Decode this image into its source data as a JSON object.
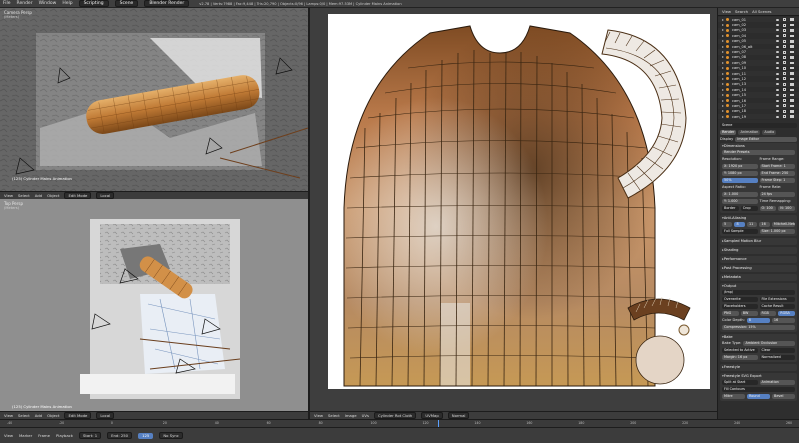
{
  "topbar": {
    "menus": [
      "File",
      "Render",
      "Window",
      "Help"
    ],
    "layout_select": "Scripting",
    "scene_select": "Scene",
    "engine_select": "Blender Render",
    "info_text": "v2.78 | Verts:7988 | Fac:9,448 | Tris:20,790 | Objects:0/96 | Lamps:0/0 | Mem:97.53M | Cylinder Mains Animation"
  },
  "camera_view": {
    "label": "Camera Persp",
    "sublabel": "(Meters)",
    "object_name": "(125) Cylinder Mains Animation",
    "header": [
      "View",
      "Select",
      "Add",
      "Object"
    ],
    "mode": "Edit Mode",
    "pivot": "Local"
  },
  "top_view": {
    "label": "Top Persp",
    "sublabel": "(Meters)",
    "object_name": "(125) Cylinder Mains Animation",
    "header": [
      "View",
      "Select",
      "Add",
      "Object"
    ],
    "mode": "Edit Mode",
    "pivot": "Local"
  },
  "uv_editor": {
    "header": [
      "View",
      "Select",
      "Image",
      "UVs"
    ],
    "image_select": "Cylinder Rot Cloth",
    "uvmap": "UVMap",
    "image_mode": "Normal"
  },
  "outliner": {
    "header": [
      "View",
      "Search",
      "All Scenes"
    ],
    "items": [
      "cam_01",
      "cam_02",
      "cam_03",
      "cam_04",
      "cam_05",
      "cam_06_alt",
      "cam_07",
      "cam_08",
      "cam_09",
      "cam_10",
      "cam_11",
      "cam_12",
      "cam_13",
      "cam_14",
      "cam_15",
      "cam_16",
      "cam_17",
      "cam_18",
      "cam_19",
      "cam_20"
    ]
  },
  "properties": {
    "scene_name": "Scene",
    "tabs": [
      "Render",
      "Animation",
      "Audio"
    ],
    "display_label": "Display",
    "display_value": "Image Editor",
    "dimensions": "Dimensions",
    "render_presets": "Render Presets",
    "resolution": "Resolution:",
    "res_x": "X: 1920 px",
    "res_y": "Y: 1080 px",
    "res_pct": "50%",
    "frame_range": "Frame Range:",
    "start_frame": "Start Frame: 1",
    "end_frame": "End Frame: 250",
    "frame_step": "Frame Step: 1",
    "aspect_ratio": "Aspect Ratio:",
    "asp_x": "X: 1.000",
    "asp_y": "Y: 1.000",
    "frame_rate": "Frame Rate:",
    "fps": "24 fps",
    "time_remap": "Time Remapping:",
    "old": "O: 100",
    "new": "N: 100",
    "border": "Border",
    "crop": "Crop",
    "anti_aliasing": "Anti-Aliasing",
    "aa_samples": [
      "5",
      "8",
      "11",
      "16"
    ],
    "filter": "Mitchell-Netravali",
    "full_sample": "Full Sample",
    "size": "Size: 1.000 px",
    "sampled_motion_blur": "Sampled Motion Blur",
    "shading": "Shading",
    "performance": "Performance",
    "post_processing": "Post Processing",
    "metadata": "Metadata",
    "output": "Output",
    "output_path": "/tmp/",
    "overwrite": "Overwrite",
    "file_extensions": "File Extensions",
    "placeholders": "Placeholders",
    "cache_result": "Cache Result",
    "format": "PNG",
    "bw": "BW",
    "rgb": "RGB",
    "rgba": "RGBA",
    "color_depth": "Color Depth:",
    "depth_8": "8",
    "depth_16": "16",
    "compression": "Compression: 15%",
    "bake": "Bake",
    "freestyle": "Freestyle",
    "bake_type": "Bake Type:",
    "bake_value": "Ambient Occlusion",
    "selected_to_active": "Selected to Active",
    "clear": "Clear",
    "margin": "Margin: 16 px",
    "normalized": "Normalized",
    "freestyle_svg": "Freestyle SVG Export",
    "split_at_start": "Split at Start",
    "animation": "Animation",
    "fill_contours": "Fill Contours",
    "mitre": "Mitre",
    "round": "Round",
    "bevel": "Bevel"
  },
  "timeline": {
    "ticks": [
      "-40",
      "-20",
      "0",
      "20",
      "40",
      "60",
      "80",
      "100",
      "120",
      "140",
      "160",
      "180",
      "200",
      "220",
      "240",
      "260"
    ],
    "current_frame": 125,
    "header": [
      "View",
      "Marker",
      "Frame",
      "Playback"
    ],
    "start": "Start: 1",
    "end": "End: 250",
    "current": "125",
    "sync": "No Sync"
  },
  "colors": {
    "accent_blue": "#5680c2",
    "fabric_orange": "#c98a45",
    "object_orange": "#e2922c"
  }
}
